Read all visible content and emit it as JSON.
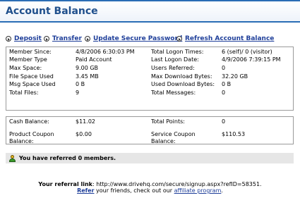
{
  "header": {
    "title": "Account Balance"
  },
  "actions": [
    {
      "label": "Deposit",
      "icon": "arrow-circle-icon"
    },
    {
      "label": "Transfer",
      "icon": "arrow-circle-icon"
    },
    {
      "label": "Update Secure Password",
      "icon": "arrow-circle-icon"
    },
    {
      "label": "Refresh Account Balance",
      "icon": "arrow-circle-icon"
    }
  ],
  "stats": {
    "rows": [
      {
        "l1": "Member Since:",
        "v1": "4/8/2006 6:30:03 PM",
        "l2": "Total Logon Times:",
        "v2": "6 (self)/ 0 (visitor)"
      },
      {
        "l1": "Member Type",
        "v1": "Paid Account",
        "l2": "Last Logon Date:",
        "v2": "4/9/2006 7:39:15 PM"
      },
      {
        "l1": "Max Space:",
        "v1": "9.00 GB",
        "l2": "Users Referred:",
        "v2": "0"
      },
      {
        "l1": "File Space Used",
        "v1": "3.45 MB",
        "l2": "Max Download Bytes:",
        "v2": "32.20 GB"
      },
      {
        "l1": "Msg Space Used",
        "v1": "0 B",
        "l2": "Used Download Bytes:",
        "v2": "0 B"
      },
      {
        "l1": "Total Files:",
        "v1": "9",
        "l2": "Total Messages:",
        "v2": "0"
      }
    ]
  },
  "money": {
    "rows": [
      {
        "l1": "Cash Balance:",
        "v1": "$11.02",
        "l2": "Total Points:",
        "v2": "0"
      },
      {
        "l1": "Product Coupon Balance:",
        "v1": "$0.00",
        "l2": "Service Coupon Balance:",
        "v2": "$110.53"
      }
    ]
  },
  "notice": {
    "icon": "user-icon",
    "text": "You have referred 0 members."
  },
  "referral": {
    "label": "Your referral link",
    "colon": ":",
    "url": " http://www.drivehq.com/secure/signup.aspx?refID=58351.",
    "refer_link": "Refer",
    "middle": " your friends, check out our ",
    "program_link": "affiliate program",
    "end": "."
  },
  "colors": {
    "accent": "#2a6db5",
    "link": "#1f3f9a",
    "title": "#1f4f8c",
    "notice_bg": "#e6e6e6"
  }
}
